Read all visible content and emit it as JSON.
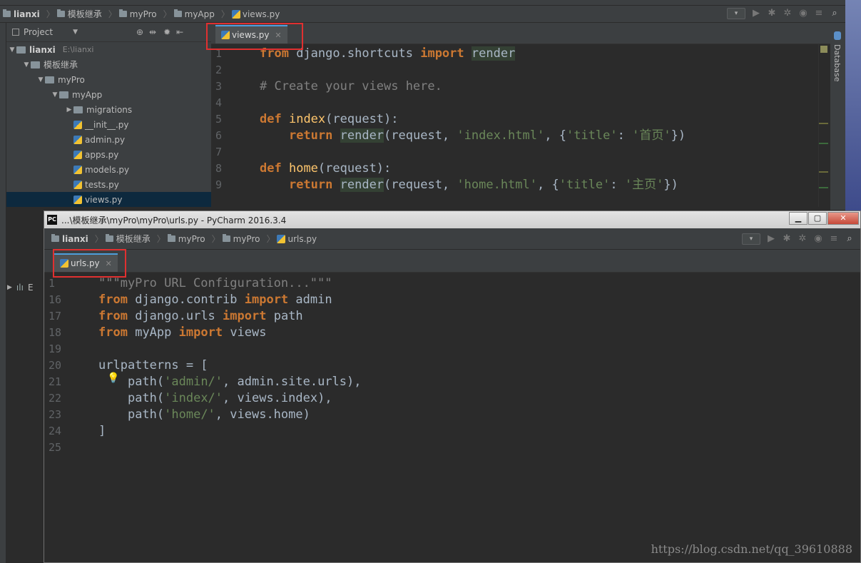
{
  "top": {
    "breadcrumbs": [
      "lianxi",
      "模板继承",
      "myPro",
      "myApp",
      "views.py"
    ],
    "dropdown": "▾"
  },
  "project": {
    "panel_title": "Project",
    "root": {
      "name": "lianxi",
      "path": "E:\\lianxi"
    },
    "tree": [
      {
        "label": "模板继承",
        "kind": "dir",
        "depth": 1,
        "expanded": true
      },
      {
        "label": "myPro",
        "kind": "dir",
        "depth": 2,
        "expanded": true
      },
      {
        "label": "myApp",
        "kind": "dir",
        "depth": 3,
        "expanded": true
      },
      {
        "label": "migrations",
        "kind": "dir",
        "depth": 4,
        "expanded": false
      },
      {
        "label": "__init__.py",
        "kind": "py",
        "depth": 4
      },
      {
        "label": "admin.py",
        "kind": "py",
        "depth": 4
      },
      {
        "label": "apps.py",
        "kind": "py",
        "depth": 4
      },
      {
        "label": "models.py",
        "kind": "py",
        "depth": 4
      },
      {
        "label": "tests.py",
        "kind": "py",
        "depth": 4
      },
      {
        "label": "views.py",
        "kind": "py",
        "depth": 4,
        "selected": true
      }
    ],
    "bottom_item": "E"
  },
  "editor1": {
    "tab": "views.py",
    "lines": [
      {
        "n": "1",
        "html": "<span class='kw'>from</span> <span class='tx'>django.shortcuts</span> <span class='kw'>import</span> <span class='hl tx'>render</span>"
      },
      {
        "n": "2",
        "html": ""
      },
      {
        "n": "3",
        "html": "<span class='cm'># Create your views here.</span>"
      },
      {
        "n": "4",
        "html": ""
      },
      {
        "n": "5",
        "html": "<span class='kw'>def</span> <span class='fn'>index</span><span class='tx'>(request):</span>"
      },
      {
        "n": "6",
        "html": "    <span class='kw'>return</span> <span class='hl tx'>render</span><span class='tx'>(request, </span><span class='str'>'index.html'</span><span class='tx'>, {</span><span class='str'>'title'</span><span class='tx'>: </span><span class='str'>'首页'</span><span class='tx'>})</span>"
      },
      {
        "n": "7",
        "html": ""
      },
      {
        "n": "8",
        "html": "<span class='kw'>def</span> <span class='fn'>home</span><span class='tx'>(request):</span>"
      },
      {
        "n": "9",
        "html": "    <span class='kw'>return</span> <span class='hl tx'>render</span><span class='tx'>(request, </span><span class='str'>'home.html'</span><span class='tx'>, {</span><span class='str'>'title'</span><span class='tx'>: </span><span class='str'>'主页'</span><span class='tx'>})</span>"
      }
    ]
  },
  "right_panel": {
    "label": "Database"
  },
  "window2": {
    "title": "...\\模板继承\\myPro\\myPro\\urls.py - PyCharm 2016.3.4",
    "app_badge": "PC",
    "breadcrumbs": [
      "lianxi",
      "模板继承",
      "myPro",
      "myPro",
      "urls.py"
    ],
    "tab": "urls.py",
    "lines": [
      {
        "n": "1",
        "html": "<span class='cm'>\"\"\"myPro URL Configuration...\"\"\"</span>"
      },
      {
        "n": "16",
        "html": "<span class='kw'>from</span> <span class='tx'>django.contrib</span> <span class='kw'>import</span> <span class='tx'>admin</span>"
      },
      {
        "n": "17",
        "html": "<span class='kw'>from</span> <span class='tx'>django.urls</span> <span class='kw'>import</span> <span class='tx'>path</span>"
      },
      {
        "n": "18",
        "html": "<span class='kw'>from</span> <span class='tx'>myApp</span> <span class='kw'>import</span> <span class='tx'>views</span>"
      },
      {
        "n": "19",
        "html": ""
      },
      {
        "n": "20",
        "html": "<span class='tx'>urlpatterns = [</span>"
      },
      {
        "n": "21",
        "html": "    <span class='tx'>path(</span><span class='str'>'admin/'</span><span class='tx'>, admin.site.urls),</span>"
      },
      {
        "n": "22",
        "html": "    <span class='tx'>path(</span><span class='str'>'index/'</span><span class='tx'>, views.index),</span>"
      },
      {
        "n": "23",
        "html": "    <span class='tx'>path(</span><span class='str'>'home/'</span><span class='tx'>, views.home)</span>"
      },
      {
        "n": "24",
        "html": "<span class='tx'>]</span>"
      },
      {
        "n": "25",
        "html": ""
      }
    ]
  },
  "watermark": "https://blog.csdn.net/qq_39610888"
}
